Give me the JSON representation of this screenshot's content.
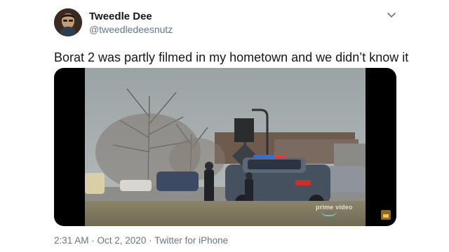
{
  "user": {
    "display_name": "Tweedle Dee",
    "handle": "@tweedledeesnutz",
    "avatar_icon": "profile-photo"
  },
  "menu_icon": "chevron-down-icon",
  "tweet": {
    "text": "Borat 2 was partly filmed in my hometown and we didn’t know it"
  },
  "media": {
    "type": "video",
    "watermark": "prime video",
    "scene": "police cars with flashing lights in parking lot"
  },
  "meta": {
    "time": "2:31 AM",
    "separator": " · ",
    "date": "Oct 2, 2020",
    "source": "Twitter for iPhone"
  },
  "colors": {
    "text_primary": "#14171a",
    "text_secondary": "#657786",
    "background": "#ffffff"
  }
}
